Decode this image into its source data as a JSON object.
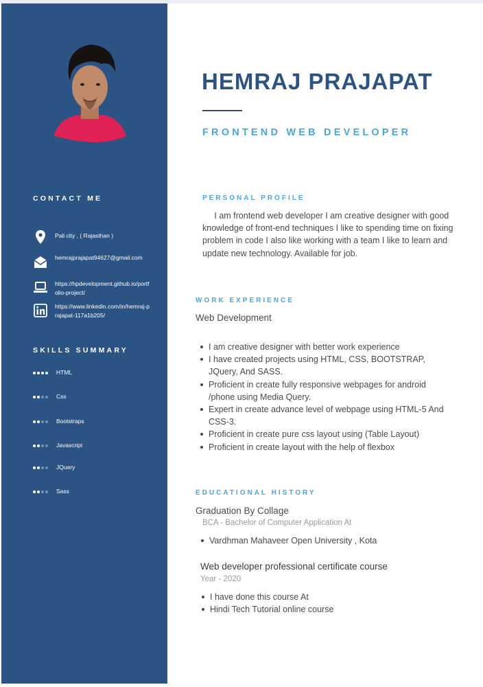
{
  "profile": {
    "name": "HEMRAJ PRAJAPAT",
    "title": "FRONTEND WEB DEVELOPER"
  },
  "sidebar": {
    "contact_heading": "CONTACT ME",
    "contact": [
      {
        "icon": "location-pin-icon",
        "text": "Pali city , ( Rajasthan )"
      },
      {
        "icon": "envelope-icon",
        "text": "hemrajprajapat94627@gmail.com"
      },
      {
        "icon": "laptop-icon",
        "text": "https://hpdevelopment.github.io/portfolio-project/"
      },
      {
        "icon": "linkedin-icon",
        "text": "https://www.linkedin.com/in/hemraj-prajapat-117a1b205/"
      }
    ],
    "skills_heading": "SKILLS SUMMARY",
    "skills": [
      {
        "label": "HTML",
        "level": 4,
        "max": 4
      },
      {
        "label": "Css",
        "level": 2,
        "max": 4
      },
      {
        "label": "Bootstraps",
        "level": 2,
        "max": 4
      },
      {
        "label": "Javascript",
        "level": 2,
        "max": 4
      },
      {
        "label": "JQuery",
        "level": 2,
        "max": 4
      },
      {
        "label": "Sass",
        "level": 2,
        "max": 4
      }
    ]
  },
  "personal_profile": {
    "heading": "PERSONAL PROFILE",
    "text": "I am frontend web developer I am creative designer with good knowledge of front-end techniques I like to spending time on fixing problem in  code I also like working with a team I like to learn and update new technology. Available for job."
  },
  "work": {
    "heading": "WORK EXPERIENCE",
    "subheading": "Web Development",
    "bullets": [
      "I am creative designer with better work experience",
      "I have created projects using HTML, CSS, BOOTSTRAP, JQuery, And SASS.",
      "Proficient in create fully responsive webpages for android /phone using Media Query.",
      "Expert in create advance level of webpage using HTML-5 And  CSS-3.",
      "Proficient in create pure css layout using (Table Layout)",
      "Proficient in  create layout with the help of flexbox"
    ]
  },
  "education": {
    "heading": "EDUCATIONAL HISTORY",
    "degree_title": "Graduation By Collage",
    "degree_detail": "BCA - Bachelor of Computer Application  At",
    "degree_bullets": [
      "Vardhman Mahaveer Open University , Kota"
    ],
    "course_title": "Web developer professional certificate course",
    "course_year": "Year - 2020",
    "course_bullets": [
      "I have done this course At",
      "Hindi Tech Tutorial online course"
    ]
  },
  "colors": {
    "sidebar": "#2b5484",
    "accent": "#4aa8d6",
    "name": "#2b5484",
    "dot_on": "#ffffff",
    "dot_off": "#6f8fb5"
  }
}
